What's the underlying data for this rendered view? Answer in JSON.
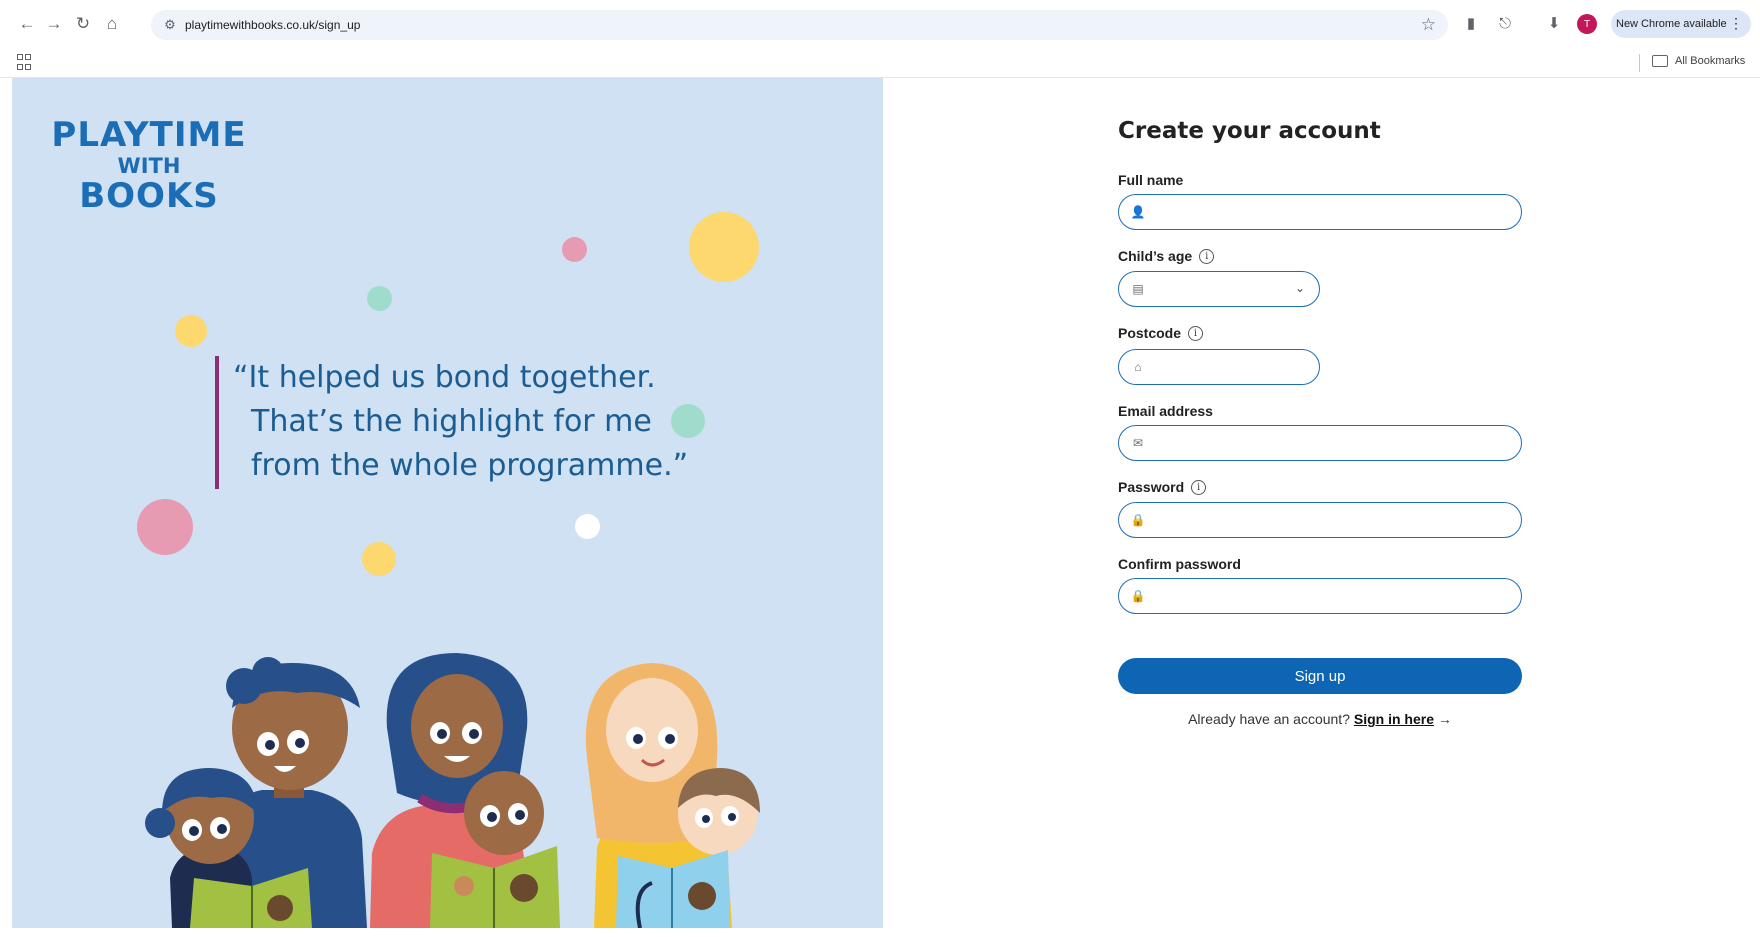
{
  "browser": {
    "url": "playtimewithbooks.co.uk/sign_up",
    "update_label": "New Chrome available",
    "avatar_initial": "T",
    "all_bookmarks": "All Bookmarks"
  },
  "brand": {
    "line1": "PLAYTIME",
    "line2": "WITH",
    "line3": "BOOKS",
    "color": "#1b6db5"
  },
  "quote": {
    "line1": "“It helped us bond together.",
    "line2": "That’s the highlight for me",
    "line3": "from the whole programme.”"
  },
  "form": {
    "title": "Create your account",
    "fields": [
      {
        "label": "Full name",
        "value": "",
        "icon": "user-icon",
        "has_info": false
      },
      {
        "label": "Child’s age",
        "value": "",
        "icon": "calendar-icon",
        "has_info": true
      },
      {
        "label": "Postcode",
        "value": "",
        "icon": "home-icon",
        "has_info": true
      },
      {
        "label": "Email address",
        "value": "",
        "icon": "envelope-icon",
        "has_info": false
      },
      {
        "label": "Password",
        "value": "",
        "icon": "lock-icon",
        "has_info": true
      },
      {
        "label": "Confirm password",
        "value": "",
        "icon": "lock-icon",
        "has_info": false
      }
    ],
    "signup_label": "Sign up",
    "signin_prompt": "Already have an account?",
    "signin_link": "Sign in here",
    "signin_arrow": "→",
    "accent": "#0e65b4"
  }
}
